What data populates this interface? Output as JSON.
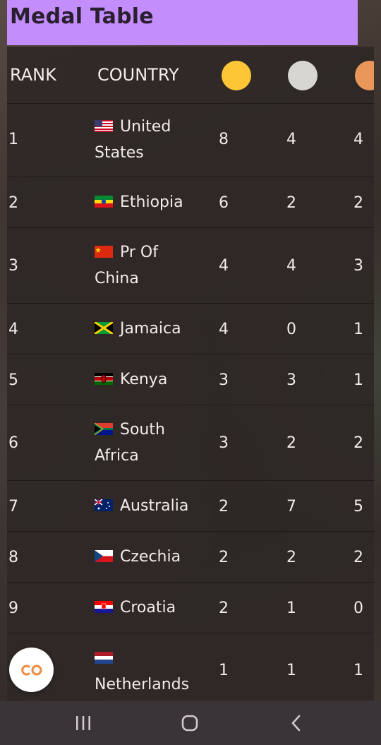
{
  "header": {
    "title": "Medal Table"
  },
  "table": {
    "columns": {
      "rank": "RANK",
      "country": "COUNTRY"
    },
    "medal_icons": {
      "gold": "gold-medal-icon",
      "silver": "silver-medal-icon",
      "bronze": "bronze-medal-icon"
    },
    "colors": {
      "gold": "#fdc636",
      "silver": "#d8d6d3",
      "bronze": "#e9965a",
      "header_bg": "#c38dfb"
    },
    "rows": [
      {
        "rank": "1",
        "country": "United States",
        "gold": "8",
        "silver": "4",
        "bronze": "4",
        "flag": "us-flag-icon"
      },
      {
        "rank": "2",
        "country": "Ethiopia",
        "gold": "6",
        "silver": "2",
        "bronze": "2",
        "flag": "ethiopia-flag-icon"
      },
      {
        "rank": "3",
        "country": "Pr Of China",
        "gold": "4",
        "silver": "4",
        "bronze": "3",
        "flag": "china-flag-icon"
      },
      {
        "rank": "4",
        "country": "Jamaica",
        "gold": "4",
        "silver": "0",
        "bronze": "1",
        "flag": "jamaica-flag-icon"
      },
      {
        "rank": "5",
        "country": "Kenya",
        "gold": "3",
        "silver": "3",
        "bronze": "1",
        "flag": "kenya-flag-icon"
      },
      {
        "rank": "6",
        "country": "South Africa",
        "gold": "3",
        "silver": "2",
        "bronze": "2",
        "flag": "south-africa-flag-icon"
      },
      {
        "rank": "7",
        "country": "Australia",
        "gold": "2",
        "silver": "7",
        "bronze": "5",
        "flag": "australia-flag-icon"
      },
      {
        "rank": "8",
        "country": "Czechia",
        "gold": "2",
        "silver": "2",
        "bronze": "2",
        "flag": "czechia-flag-icon"
      },
      {
        "rank": "9",
        "country": "Croatia",
        "gold": "2",
        "silver": "1",
        "bronze": "0",
        "flag": "croatia-flag-icon"
      },
      {
        "rank": "",
        "country": "Netherlands",
        "gold": "1",
        "silver": "1",
        "bronze": "1",
        "flag": "netherlands-flag-icon"
      }
    ]
  },
  "fab": {
    "icon": "co-logo-icon"
  },
  "navbar": {
    "recents": "recents-icon",
    "home": "home-icon",
    "back": "back-icon"
  }
}
